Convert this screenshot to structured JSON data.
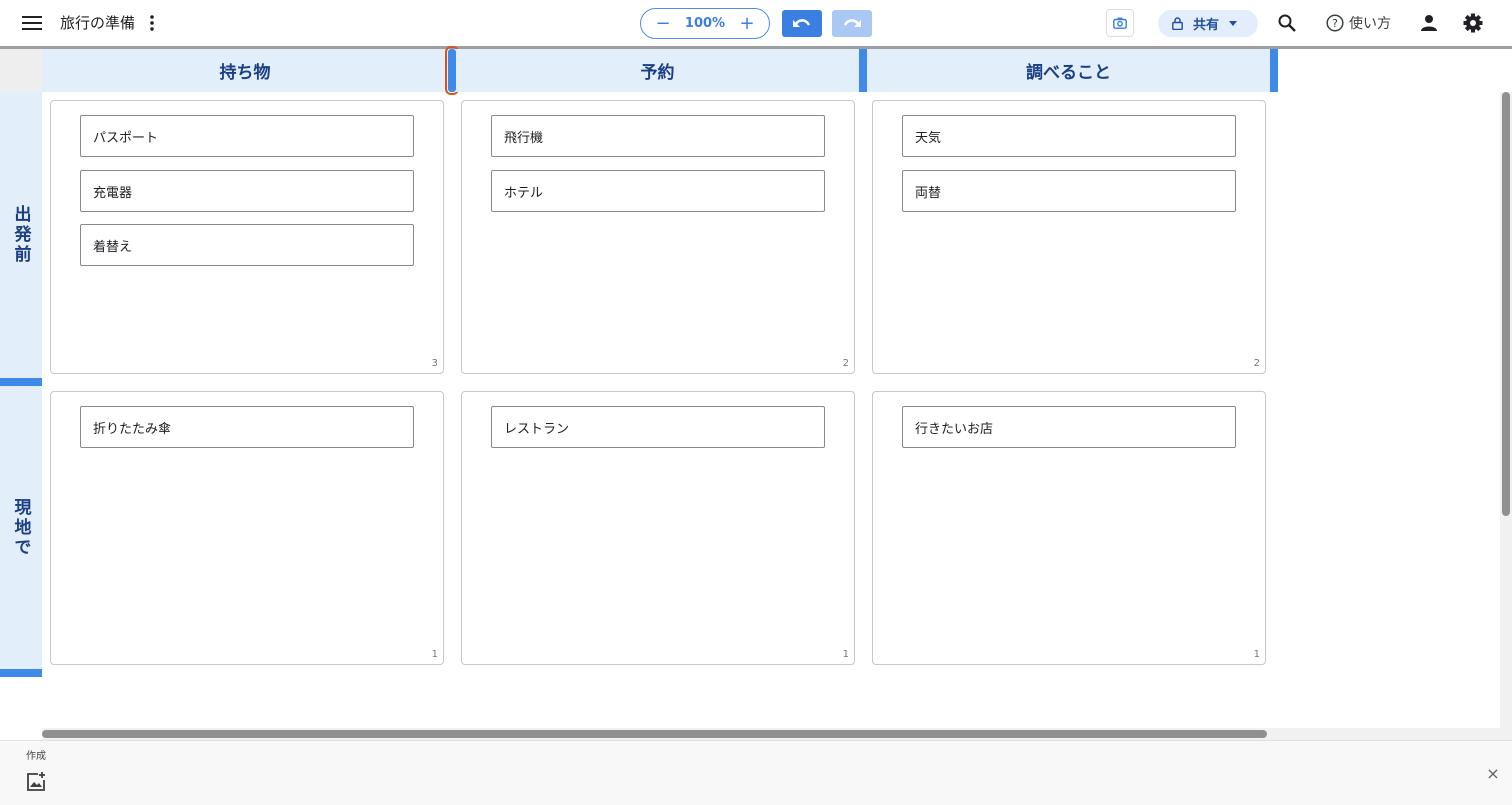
{
  "header": {
    "menu_icon": "hamburger-icon",
    "title": "旅行の準備",
    "more_icon": "vertical-dots-icon",
    "zoom": {
      "minus": "−",
      "value": "100%",
      "plus": "+"
    },
    "undo_icon": "undo-icon",
    "redo_icon": "redo-icon",
    "camera_icon": "camera-icon",
    "share": {
      "lock_icon": "lock-icon",
      "label": "共有",
      "caret_icon": "caret-down-icon"
    },
    "search_icon": "search-icon",
    "help": {
      "icon": "help-circle-icon",
      "label": "使い方"
    },
    "account_icon": "person-icon",
    "settings_icon": "gear-icon"
  },
  "board": {
    "columns": [
      "持ち物",
      "予約",
      "調べること"
    ],
    "rows": [
      {
        "label": "出発前",
        "cells": [
          {
            "cards": [
              "パスポート",
              "充電器",
              "着替え"
            ],
            "count": "3"
          },
          {
            "cards": [
              "飛行機",
              "ホテル"
            ],
            "count": "2"
          },
          {
            "cards": [
              "天気",
              "両替"
            ],
            "count": "2"
          }
        ]
      },
      {
        "label": "現地で",
        "cells": [
          {
            "cards": [
              "折りたたみ傘"
            ],
            "count": "1"
          },
          {
            "cards": [
              "レストラン"
            ],
            "count": "1"
          },
          {
            "cards": [
              "行きたいお店"
            ],
            "count": "1"
          }
        ]
      }
    ]
  },
  "bottom_panel": {
    "label": "作成",
    "create_icon": "add-image-icon",
    "close": "×"
  },
  "colors": {
    "accent": "#3f8ae8",
    "header_bg": "#e3eefb",
    "header_text": "#1a3f84",
    "selected_outline": "#d9531e"
  }
}
